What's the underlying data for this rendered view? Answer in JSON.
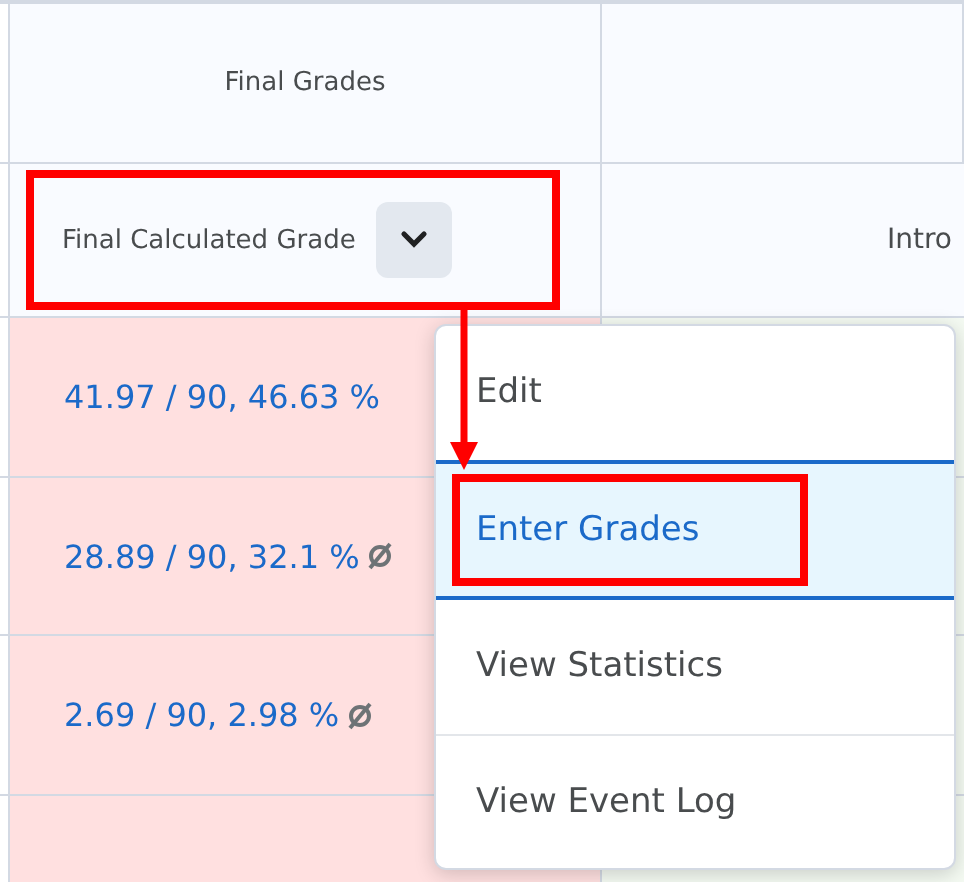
{
  "table": {
    "group_header": "Final Grades",
    "columns": [
      {
        "label": "Final Calculated Grade",
        "highlighted": true
      },
      {
        "label": "Intro",
        "highlighted": false
      }
    ],
    "rows": [
      {
        "grade": "41.97 / 90, 46.63 %",
        "excluded": false
      },
      {
        "grade": "28.89 / 90, 32.1 %",
        "excluded": true
      },
      {
        "grade": "2.69 / 90, 2.98 %",
        "excluded": true
      }
    ]
  },
  "menu": {
    "items": [
      {
        "label": "Edit",
        "selected": false,
        "highlighted": false
      },
      {
        "label": "Enter Grades",
        "selected": true,
        "highlighted": true
      },
      {
        "label": "View Statistics",
        "selected": false,
        "highlighted": false
      },
      {
        "label": "View Event Log",
        "selected": false,
        "highlighted": false
      }
    ]
  }
}
